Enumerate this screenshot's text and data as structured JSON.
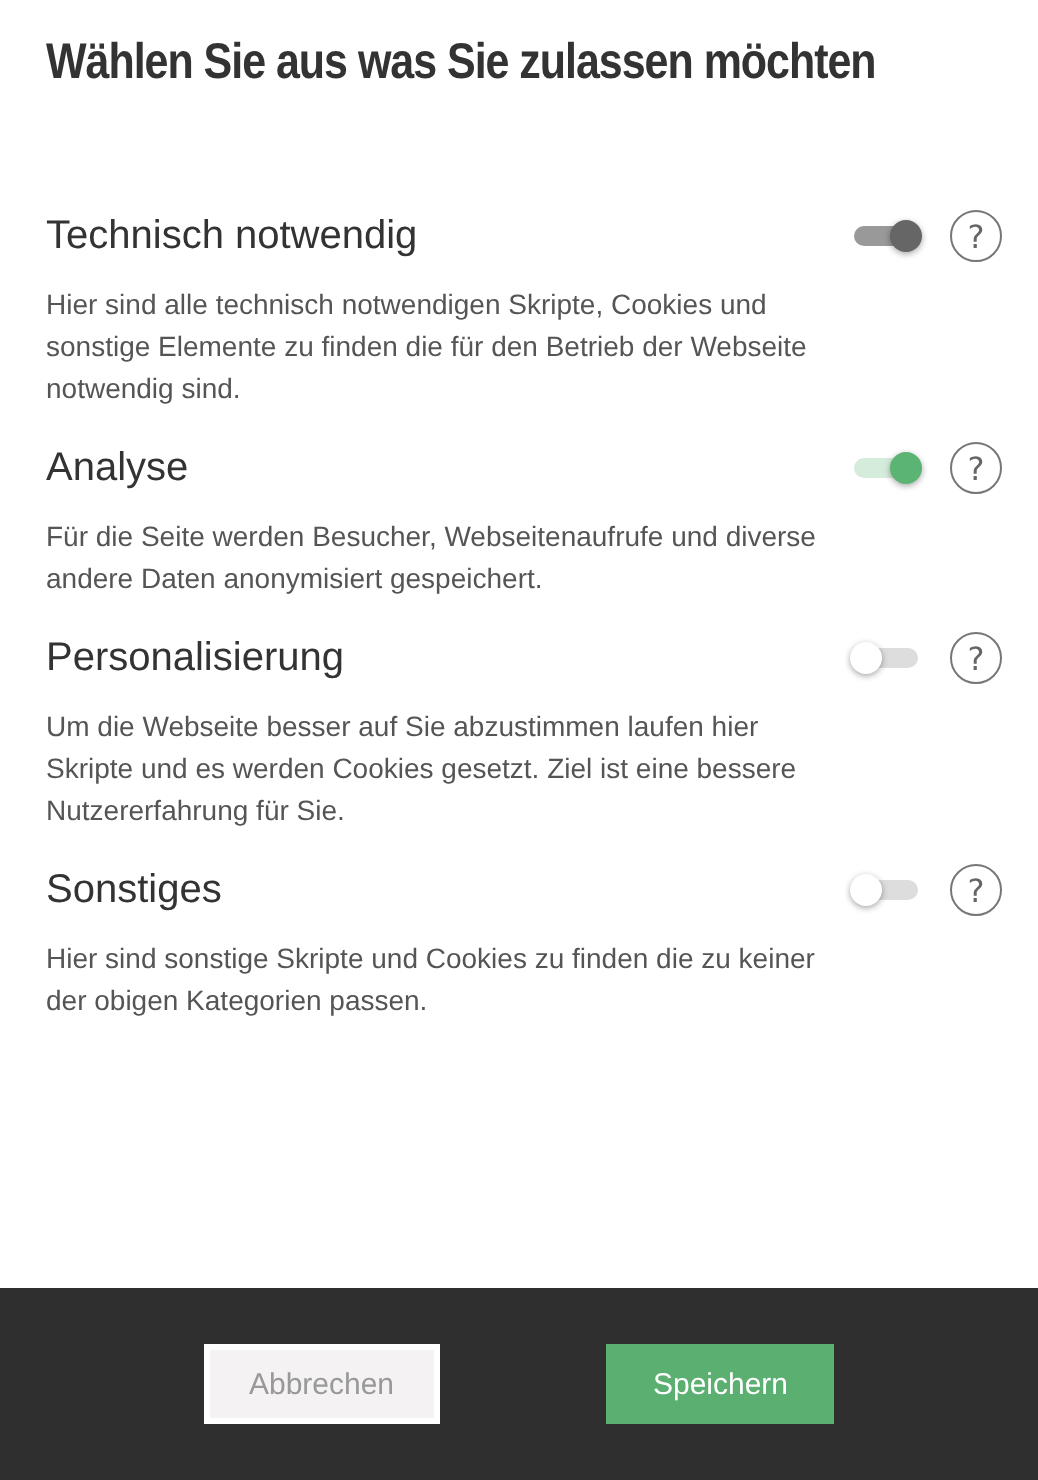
{
  "title": "Wählen Sie aus was Sie zulassen möchten",
  "categories": [
    {
      "name": "Technisch notwendig",
      "on": true,
      "disabled": true,
      "help": "?",
      "description": "Hier sind alle technisch notwendigen Skripte, Cookies und sonstige Elemente zu finden die für den Betrieb der Webseite notwendig sind."
    },
    {
      "name": "Analyse",
      "on": true,
      "disabled": false,
      "help": "?",
      "description": "Für die Seite werden Besucher, Webseitenaufrufe und diverse andere Daten anonymisiert gespeichert."
    },
    {
      "name": "Personalisierung",
      "on": false,
      "disabled": false,
      "help": "?",
      "description": "Um die Webseite besser auf Sie abzustimmen laufen hier Skripte und es werden Cookies gesetzt. Ziel ist eine bessere Nutzererfahrung für Sie."
    },
    {
      "name": "Sonstiges",
      "on": false,
      "disabled": false,
      "help": "?",
      "description": "Hier sind sonstige Skripte und Cookies zu finden die zu keiner der obigen Kategorien passen."
    }
  ],
  "buttons": [
    {
      "label": "Abbrechen",
      "kind": "secondary"
    },
    {
      "label": "Speichern",
      "kind": "primary"
    }
  ]
}
